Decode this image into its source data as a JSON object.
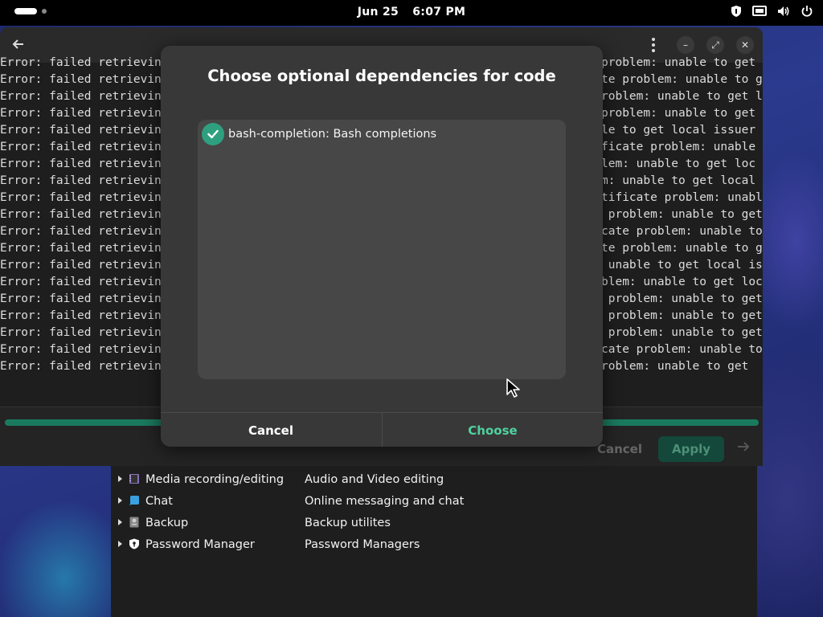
{
  "topbar": {
    "date": "Jun 25",
    "time": "6:07 PM"
  },
  "app": {
    "log_left": "Error: failed retrievin",
    "log_right": [
      "problem: unable to get l",
      "te problem: unable to g",
      "roblem: unable to get l",
      "problem: unable to get",
      "le to get local issuer",
      "ficate problem: unable",
      "lem: unable to get loc",
      "m: unable to get local",
      "tificate problem: unabl",
      " problem: unable to get",
      "cate problem: unable to",
      "te problem: unable to g",
      " unable to get local is",
      "blem: unable to get loc",
      " problem: unable to get",
      " problem: unable to get",
      " problem: unable to get",
      "cate problem: unable to",
      "roblem: unable to get"
    ],
    "cancel_label": "Cancel",
    "apply_label": "Apply"
  },
  "categories": [
    {
      "name": "Media recording/editing",
      "desc": "Audio and Video editing",
      "icon": "film-icon"
    },
    {
      "name": "Chat",
      "desc": "Online messaging and chat",
      "icon": "chat-icon"
    },
    {
      "name": "Backup",
      "desc": "Backup utilites",
      "icon": "backup-icon"
    },
    {
      "name": "Password Manager",
      "desc": "Password Managers",
      "icon": "shield-icon"
    }
  ],
  "dialog": {
    "title": "Choose optional dependencies for code",
    "items": [
      {
        "label": "bash-completion: Bash completions",
        "checked": true
      }
    ],
    "cancel_label": "Cancel",
    "choose_label": "Choose"
  },
  "colors": {
    "accent": "#2ea080",
    "choose_text": "#4fd1a0",
    "dialog_bg": "#383838",
    "list_bg": "#474747"
  }
}
